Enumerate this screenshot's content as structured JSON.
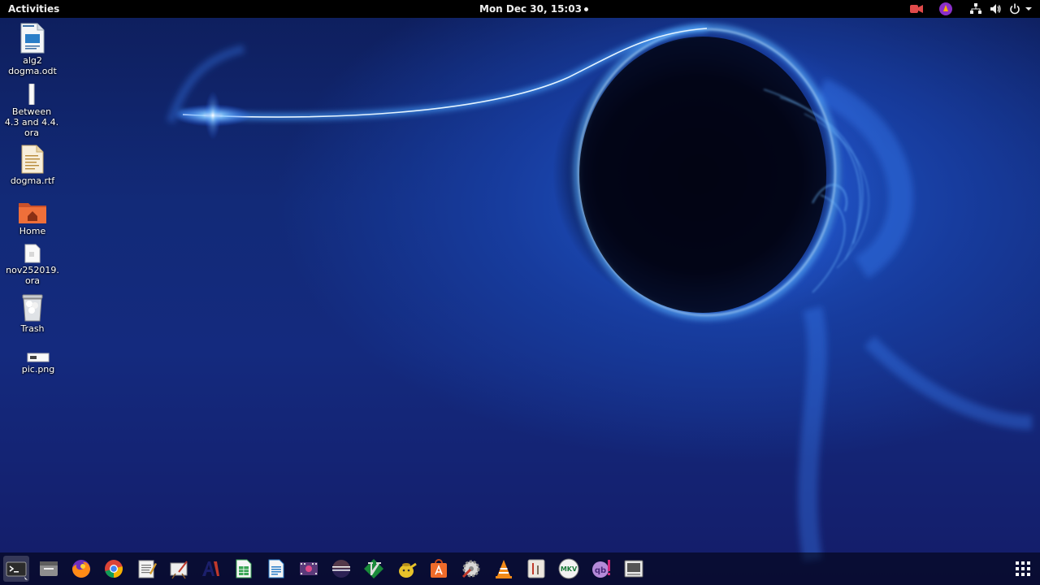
{
  "topbar": {
    "activities": "Activities",
    "clock": "Mon Dec 30, 15:03"
  },
  "tray_icons": [
    "screen-recorder-icon",
    "firefox-extension-icon",
    "network-icon",
    "volume-icon",
    "power-icon",
    "chevron-down-icon"
  ],
  "desktop": {
    "icons": [
      {
        "label": "alg2\ndogma.odt",
        "icon": "writer-document-icon"
      },
      {
        "label": "Between\n4.3 and 4.4.\nora",
        "icon": "ora-file-icon"
      },
      {
        "label": "dogma.rtf",
        "icon": "rtf-document-icon"
      },
      {
        "label": "Home",
        "icon": "home-folder-icon"
      },
      {
        "label": "nov252019.\nora",
        "icon": "ora-file-icon"
      },
      {
        "label": "Trash",
        "icon": "trash-icon"
      },
      {
        "label": "pic.png",
        "icon": "image-file-icon"
      }
    ]
  },
  "dock": {
    "apps": [
      "terminal",
      "files",
      "firefox",
      "chrome",
      "text-editor",
      "drawing",
      "ae-app",
      "libreoffice-calc",
      "libreoffice-writer",
      "video-editor",
      "eclipse",
      "vim",
      "gnome-java-app",
      "software-center",
      "settings-tool",
      "vlc",
      "system-monitor",
      "mkv-toolnix",
      "qbittorrent",
      "screenshot-tool"
    ],
    "show_apps": "show-applications-icon"
  },
  "colors": {
    "topbar": "#000000",
    "wallpaper_base": "#142a7e",
    "glow": "#4aa3ff"
  }
}
